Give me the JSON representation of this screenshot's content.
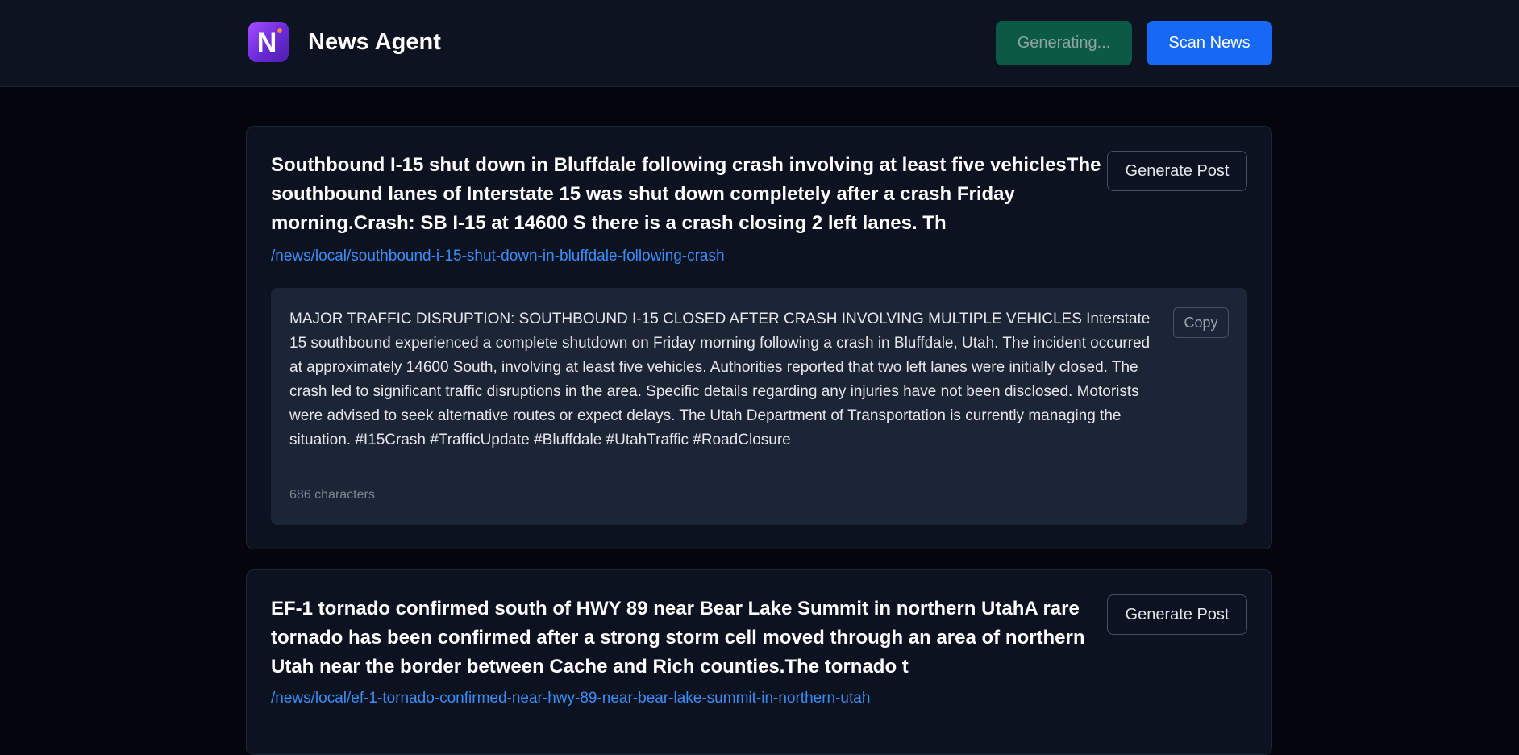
{
  "header": {
    "logo_letter": "N",
    "app_title": "News Agent",
    "generating_label": "Generating...",
    "scan_label": "Scan News"
  },
  "articles": [
    {
      "title": "Southbound I-15 shut down in Bluffdale following crash involving at least five vehiclesThe southbound lanes of Interstate 15 was shut down completely after a crash Friday morning.Crash: SB I-15 at 14600 S there is a crash closing 2 left lanes. Th",
      "link": "/news/local/southbound-i-15-shut-down-in-bluffdale-following-crash",
      "generate_label": "Generate Post",
      "post": {
        "text": "MAJOR TRAFFIC DISRUPTION: SOUTHBOUND I-15 CLOSED AFTER CRASH INVOLVING MULTIPLE VEHICLES Interstate 15 southbound experienced a complete shutdown on Friday morning following a crash in Bluffdale, Utah. The incident occurred at approximately 14600 South, involving at least five vehicles. Authorities reported that two left lanes were initially closed. The crash led to significant traffic disruptions in the area. Specific details regarding any injuries have not been disclosed. Motorists were advised to seek alternative routes or expect delays. The Utah Department of Transportation is currently managing the situation. #I15Crash #TrafficUpdate #Bluffdale #UtahTraffic #RoadClosure",
        "char_count": "686 characters",
        "copy_label": "Copy"
      }
    },
    {
      "title": "EF-1 tornado confirmed south of HWY 89 near Bear Lake Summit in northern UtahA rare tornado has been confirmed after a strong storm cell moved through an area of northern Utah near the border between Cache and Rich counties.The tornado t",
      "link": "/news/local/ef-1-tornado-confirmed-near-hwy-89-near-bear-lake-summit-in-northern-utah",
      "generate_label": "Generate Post"
    }
  ]
}
